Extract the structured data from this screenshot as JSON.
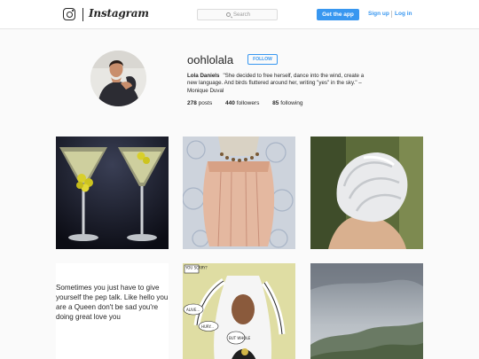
{
  "header": {
    "logo_icon": "instagram-camera-icon",
    "wordmark": "Instagram",
    "search_placeholder": "Search",
    "get_app": "Get the app",
    "signup": "Sign up",
    "login": "Log in",
    "accent_color": "#3897f0"
  },
  "profile": {
    "username": "oohlolala",
    "follow_label": "FOLLOW",
    "full_name": "Lola Daniels",
    "bio": "\"She decided to free herself, dance into the wind, create a new language. And birds fluttered around her, writing \"yes\" in the sky.\" – Monique Duval",
    "stats": {
      "posts": {
        "count": "278",
        "label": "posts"
      },
      "followers": {
        "count": "440",
        "label": "followers"
      },
      "following": {
        "count": "85",
        "label": "following"
      }
    }
  },
  "posts": [
    {
      "name": "post-martini-glasses"
    },
    {
      "name": "post-peach-corset-dress"
    },
    {
      "name": "post-white-hair"
    },
    {
      "name": "post-text-quote",
      "text": "Sometimes you just have to give yourself the pep talk. Like hello you are a Queen don't be sad you're doing great love you"
    },
    {
      "name": "post-comic-panel",
      "bubbles": [
        "YOU SCARY?",
        "ALIVE...",
        "HURY...",
        "BUT WHOLE"
      ]
    },
    {
      "name": "post-misty-mountains"
    }
  ]
}
